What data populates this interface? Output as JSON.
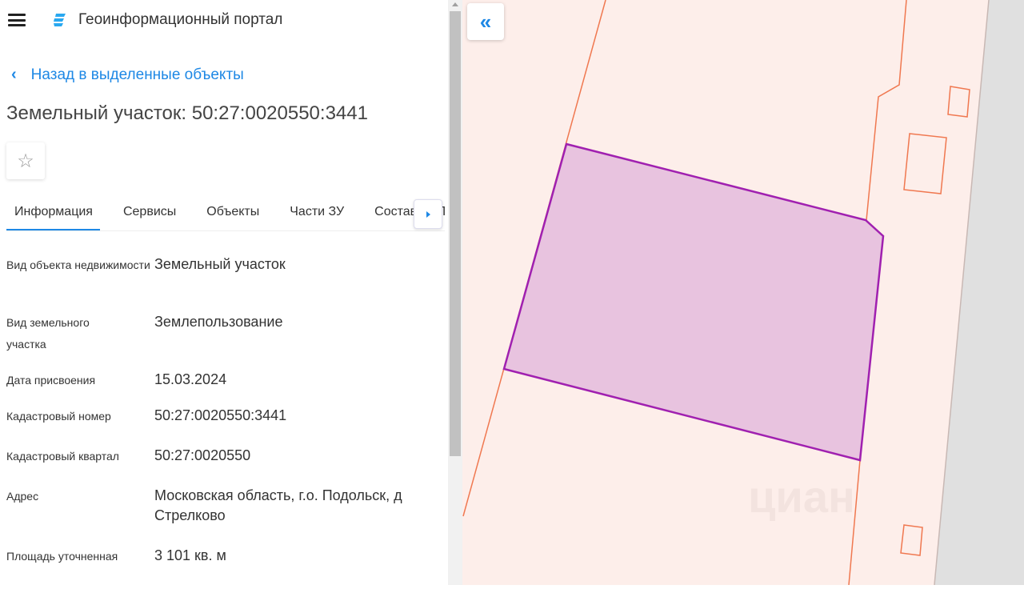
{
  "header": {
    "title": "Геоинформационный портал"
  },
  "back_link": "Назад в выделенные объекты",
  "title": "Земельный участок: 50:27:0020550:3441",
  "tabs": [
    "Информация",
    "Сервисы",
    "Объекты",
    "Части ЗУ",
    "Состав ЕЗП"
  ],
  "fields": [
    {
      "label": "Вид объекта недвижимости",
      "value": "Земельный участок"
    },
    {
      "label": "Вид земельного участка",
      "value": "Землепользование"
    },
    {
      "label": "Дата присвоения",
      "value": "15.03.2024"
    },
    {
      "label": "Кадастровый номер",
      "value": "50:27:0020550:3441"
    },
    {
      "label": "Кадастровый квартал",
      "value": "50:27:0020550"
    },
    {
      "label": "Адрес",
      "value": "Московская область, г.о. Подольск, д Стрелково"
    },
    {
      "label": "Площадь уточненная",
      "value": "3 101 кв. м"
    }
  ],
  "map": {
    "watermark": "циан",
    "colors": {
      "parcel_fill": "#e8c3df",
      "parcel_stroke": "#a020b0",
      "boundary": "#f07850",
      "background": "#fdeeea",
      "outside": "#e0e0e0"
    }
  },
  "colors": {
    "accent": "#1e88e5"
  }
}
